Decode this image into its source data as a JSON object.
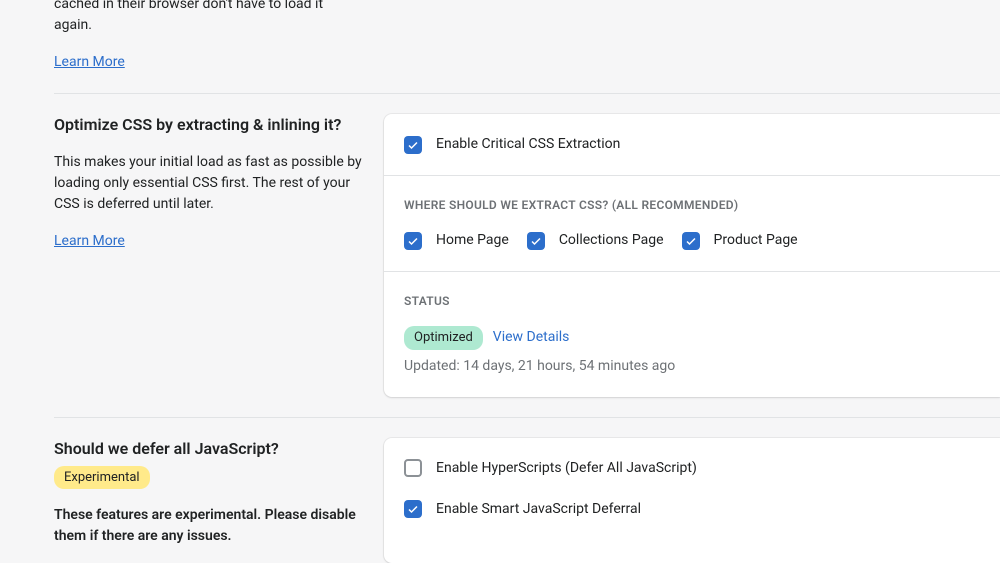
{
  "section_prev": {
    "desc_tail": "cached in their browser don't have to load it again.",
    "learn_more": "Learn More"
  },
  "section_css": {
    "title": "Optimize CSS by extracting & inlining it?",
    "desc": "This makes your initial load as fast as possible by loading only essential CSS first. The rest of your CSS is deferred until later.",
    "learn_more": "Learn More",
    "enable_label": "Enable Critical CSS Extraction",
    "where_heading": "WHERE SHOULD WE EXTRACT CSS? (ALL RECOMMENDED)",
    "opt_home": "Home Page",
    "opt_collections": "Collections Page",
    "opt_product": "Product Page",
    "status_heading": "STATUS",
    "status_badge": "Optimized",
    "view_details": "View Details",
    "updated": "Updated: 14 days, 21 hours, 54 minutes ago"
  },
  "section_js": {
    "title": "Should we defer all JavaScript?",
    "badge": "Experimental",
    "desc": "These features are experimental. Please disable them if there are any issues.",
    "hyperscripts_label": "Enable HyperScripts (Defer All JavaScript)",
    "smart_label": "Enable Smart JavaScript Deferral"
  }
}
